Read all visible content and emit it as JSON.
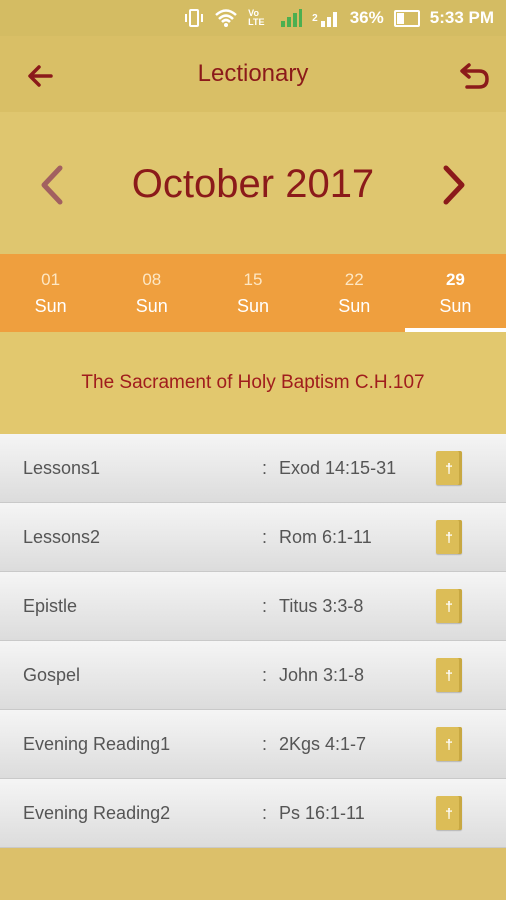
{
  "status_bar": {
    "battery": "36%",
    "time": "5:33 PM",
    "volte": "Vo LTE",
    "sim": "2"
  },
  "appbar": {
    "title": "Lectionary"
  },
  "month": {
    "label": "October 2017"
  },
  "tabs": [
    {
      "date": "01",
      "day": "Sun"
    },
    {
      "date": "08",
      "day": "Sun"
    },
    {
      "date": "15",
      "day": "Sun"
    },
    {
      "date": "22",
      "day": "Sun"
    },
    {
      "date": "29",
      "day": "Sun"
    }
  ],
  "service": {
    "title": "The Sacrament of Holy Baptism C.H.107"
  },
  "readings": [
    {
      "name": "Lessons1",
      "sep": ":",
      "ref": "Exod 14:15-31"
    },
    {
      "name": "Lessons2",
      "sep": ":",
      "ref": "Rom 6:1-11"
    },
    {
      "name": "Epistle",
      "sep": ":",
      "ref": "Titus 3:3-8"
    },
    {
      "name": "Gospel",
      "sep": ":",
      "ref": "John 3:1-8"
    },
    {
      "name": "Evening Reading1",
      "sep": ":",
      "ref": "2Kgs 4:1-7"
    },
    {
      "name": "Evening Reading2",
      "sep": ":",
      "ref": "Ps 16:1-11"
    }
  ],
  "book_glyph": "†",
  "colors": {
    "accent": "#8b1a1a",
    "tab_bar": "#ef9f3e",
    "background": "#dcc06a"
  },
  "icons": [
    "vibrate-icon",
    "wifi-icon",
    "signal-icon",
    "battery-icon",
    "back-arrow-icon",
    "undo-icon",
    "chevron-left-icon",
    "chevron-right-icon",
    "bible-book-icon"
  ]
}
